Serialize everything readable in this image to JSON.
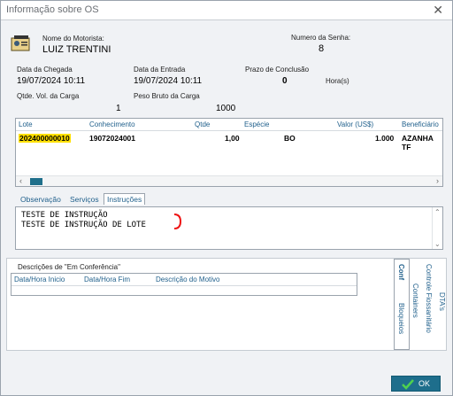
{
  "window": {
    "title": "Informação sobre OS"
  },
  "driver": {
    "label": "Nome do Motorista:",
    "name": "LUIZ TRENTINI"
  },
  "password": {
    "label": "Numero da Senha:",
    "value": "8"
  },
  "arrival": {
    "label": "Data da Chegada",
    "value": "19/07/2024 10:11"
  },
  "entry": {
    "label": "Data da Entrada",
    "value": "19/07/2024 10:11"
  },
  "deadline": {
    "label": "Prazo de Conclusão",
    "value": "0",
    "unit": "Hora(s)"
  },
  "volumes": {
    "label": "Qtde. Vol. da Carga",
    "value": "1"
  },
  "weight": {
    "label": "Peso Bruto da Carga",
    "value": "1000"
  },
  "grid": {
    "headers": {
      "lote": "Lote",
      "conhecimento": "Conhecimento",
      "qtde": "Qtde",
      "especie": "Espécie",
      "valor": "Valor (US$)",
      "beneficiario": "Beneficiário"
    },
    "rows": [
      {
        "lote": "202400000010",
        "conhecimento": "19072024001",
        "qtde": "1,00",
        "especie": "BO",
        "valor": "1.000",
        "beneficiario": "AZANHA TF"
      }
    ]
  },
  "tabs": {
    "observacao": "Observação",
    "servicos": "Serviços",
    "instrucoes": "Instruções"
  },
  "instructions": {
    "line1": "TESTE DE INSTRUÇÃO",
    "line2": "TESTE DE INSTRUÇÃO DE LOTE"
  },
  "conference": {
    "title": "Descrições de \"Em Conferência\"",
    "headers": {
      "inicio": "Data/Hora Inicio",
      "fim": "Data/Hora Fim",
      "motivo": "Descrição do Motivo"
    }
  },
  "side_tabs": {
    "conf": "Conf",
    "bloqueios": "Bloqueios",
    "containers": "Containers",
    "controle": "Controle Fiossanitário",
    "dtas": "DTA's"
  },
  "ok_button": {
    "label": "OK"
  },
  "colors": {
    "accent": "#1e6e8c",
    "highlight": "#ffe000",
    "mark": "#e11"
  }
}
